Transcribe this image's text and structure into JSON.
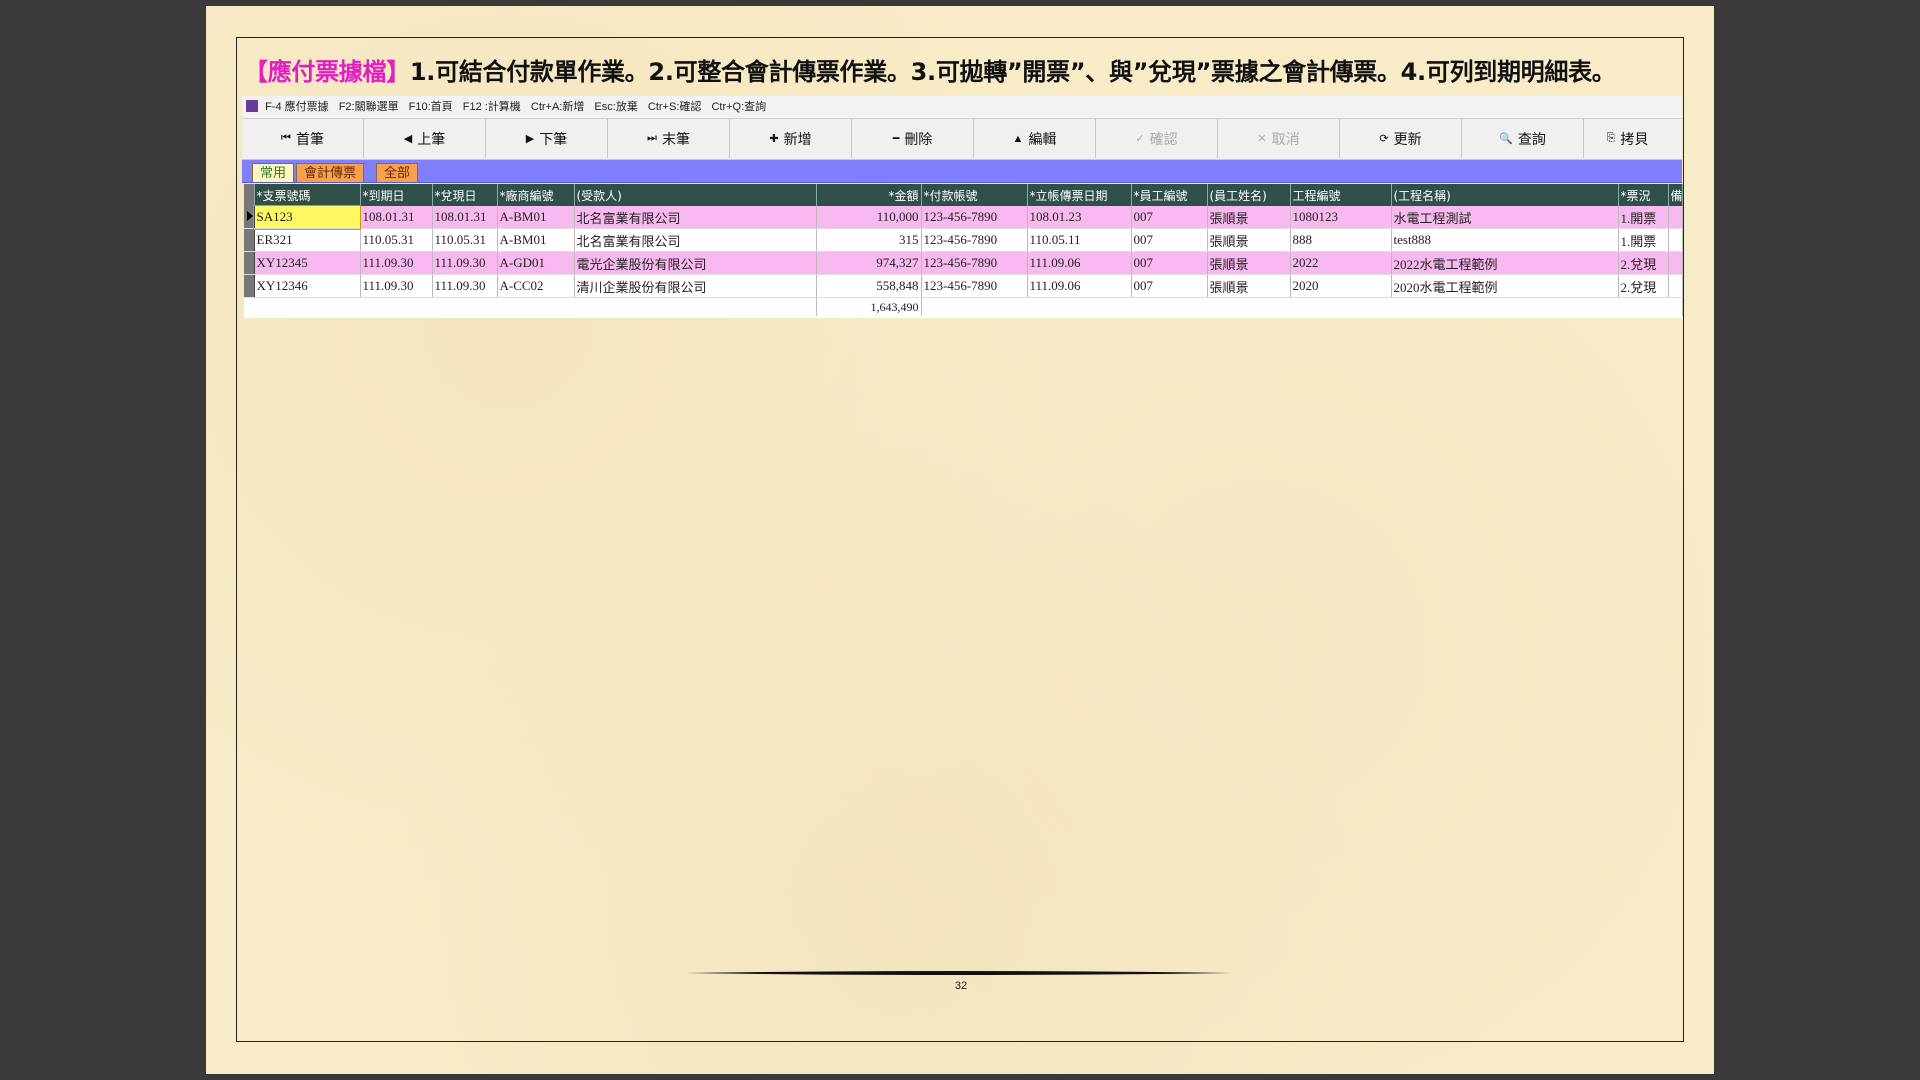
{
  "title": {
    "highlight": "【應付票據檔】",
    "text": "1.可結合付款單作業。2.可整合會計傳票作業。3.可拋轉”開票”、與”兌現”票據之會計傳票。4.可列到期明細表。"
  },
  "shortcut_bar": {
    "items": [
      "F-4 應付票據",
      "F2:關聯選單",
      "F10:首頁",
      "F12 :計算機",
      "Ctr+A:新增",
      "Esc:放棄",
      "Ctr+S:確認",
      "Ctr+Q:查詢"
    ]
  },
  "toolbar": {
    "buttons": [
      {
        "label": "首筆",
        "icon": "⏮"
      },
      {
        "label": "上筆",
        "icon": "◀"
      },
      {
        "label": "下筆",
        "icon": "▶"
      },
      {
        "label": "末筆",
        "icon": "⏭"
      },
      {
        "label": "新增",
        "icon": "✚"
      },
      {
        "label": "刪除",
        "icon": "━"
      },
      {
        "label": "編輯",
        "icon": "▲"
      },
      {
        "label": "確認",
        "icon": "✓"
      },
      {
        "label": "取消",
        "icon": "✕"
      },
      {
        "label": "更新",
        "icon": "⟳"
      },
      {
        "label": "查詢",
        "icon": "🔍"
      },
      {
        "label": "拷貝",
        "icon": "⎘"
      }
    ]
  },
  "tabs": [
    "常用",
    "會計傳票",
    "全部"
  ],
  "grid": {
    "columns": [
      "*支票號碼",
      "*到期日",
      "*兌現日",
      "*廠商編號",
      "(受款人)",
      "*金額",
      "*付款帳號",
      "*立帳傳票日期",
      "*員工編號",
      "(員工姓名)",
      "工程編號",
      "(工程名稱)",
      "*票況",
      "備"
    ],
    "rows": [
      [
        "SA123",
        "108.01.31",
        "108.01.31",
        "A-BM01",
        "北名富業有限公司",
        "110,000",
        "123-456-7890",
        "108.01.23",
        "007",
        "張順景",
        "1080123",
        "水電工程測試",
        "1.開票",
        ""
      ],
      [
        "ER321",
        "110.05.31",
        "110.05.31",
        "A-BM01",
        "北名富業有限公司",
        "315",
        "123-456-7890",
        "110.05.11",
        "007",
        "張順景",
        "888",
        "test888",
        "1.開票",
        ""
      ],
      [
        "XY12345",
        "111.09.30",
        "111.09.30",
        "A-GD01",
        "電光企業股份有限公司",
        "974,327",
        "123-456-7890",
        "111.09.06",
        "007",
        "張順景",
        "2022",
        "2022水電工程範例",
        "2.兌現",
        ""
      ],
      [
        "XY12346",
        "111.09.30",
        "111.09.30",
        "A-CC02",
        "清川企業股份有限公司",
        "558,848",
        "123-456-7890",
        "111.09.06",
        "007",
        "張順景",
        "2020",
        "2020水電工程範例",
        "2.兌現",
        ""
      ]
    ],
    "total": "1,643,490"
  },
  "page_number": "32"
}
